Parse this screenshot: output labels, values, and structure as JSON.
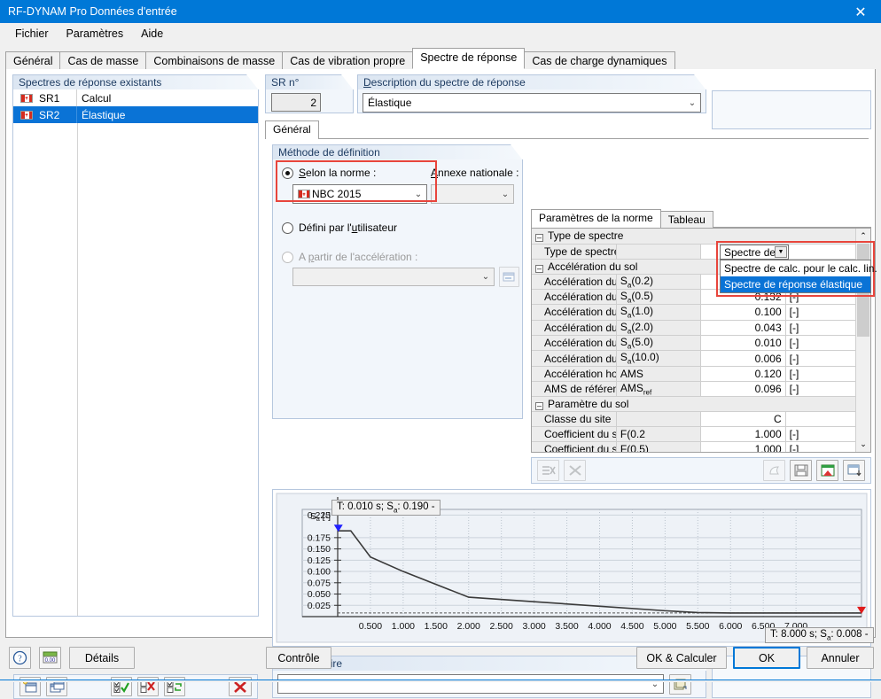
{
  "window": {
    "title": "RF-DYNAM Pro Données d'entrée",
    "close_icon": "close-icon"
  },
  "menu": {
    "items": [
      "Fichier",
      "Paramètres",
      "Aide"
    ]
  },
  "main_tabs": {
    "items": [
      "Général",
      "Cas de masse",
      "Combinaisons de masse",
      "Cas de vibration propre",
      "Spectre de réponse",
      "Cas de charge dynamiques"
    ],
    "active": "Spectre de réponse"
  },
  "existing_spectra": {
    "title": "Spectres de réponse existants",
    "rows": [
      {
        "id": "SR1",
        "desc": "Calcul",
        "flag": "canada-flag-icon",
        "selected": false
      },
      {
        "id": "SR2",
        "desc": "Élastique",
        "flag": "canada-flag-icon",
        "selected": true
      }
    ],
    "toolbar": [
      {
        "name": "new-spectrum-button",
        "glyph": "⊞"
      },
      {
        "name": "copy-spectrum-button",
        "glyph": "⧉"
      },
      {
        "name": "select-all-button",
        "glyph": "☑"
      },
      {
        "name": "deselect-all-button",
        "glyph": "☒"
      },
      {
        "name": "invert-selection-button",
        "glyph": "⮂"
      },
      {
        "name": "delete-spectrum-button",
        "glyph": "✕"
      }
    ]
  },
  "sr_number": {
    "title": "SR n°",
    "value": "2"
  },
  "description": {
    "title": "Description du spectre de réponse",
    "value": "Élastique",
    "chevron": "chevron-down-icon"
  },
  "general_subtab": {
    "label": "Général"
  },
  "definition_method": {
    "title": "Méthode de définition",
    "option_standard": "Selon la norme :",
    "option_standard_selected": true,
    "standard_value": "NBC 2015",
    "standard_flag": "canada-flag-icon",
    "national_annex_label": "Annexe nationale :",
    "national_annex_value": "",
    "option_user": "Défini par l'utilisateur",
    "option_user_selected": false,
    "option_from_accel": "A partir de l'accélération :",
    "option_from_accel_selected": false,
    "accel_value": "",
    "accel_browse_icon": "import-icon"
  },
  "params_panel": {
    "tabs": [
      {
        "label": "Paramètres de la norme",
        "active": true
      },
      {
        "label": "Tableau",
        "active": false
      }
    ],
    "rows": [
      {
        "type": "group",
        "label": "Type de spectre"
      },
      {
        "type": "item",
        "label": "Type de spectre",
        "symbol": "",
        "value": "",
        "unit": ""
      },
      {
        "type": "group",
        "label": "Accélération du sol"
      },
      {
        "type": "item",
        "label": "Accélération du spectre pou",
        "symbol": "Sa(0.2)",
        "value": "",
        "unit": "[-]"
      },
      {
        "type": "item",
        "label": "Accélération du spectre pou",
        "symbol": "Sa(0.5)",
        "value": "0.132",
        "unit": "[-]"
      },
      {
        "type": "item",
        "label": "Accélération du spectre pou",
        "symbol": "Sa(1.0)",
        "value": "0.100",
        "unit": "[-]"
      },
      {
        "type": "item",
        "label": "Accélération du spectre pou",
        "symbol": "Sa(2.0)",
        "value": "0.043",
        "unit": "[-]"
      },
      {
        "type": "item",
        "label": "Accélération du spectre pou",
        "symbol": "Sa(5.0)",
        "value": "0.010",
        "unit": "[-]"
      },
      {
        "type": "item",
        "label": "Accélération du spectre pou",
        "symbol": "Sa(10.0)",
        "value": "0.006",
        "unit": "[-]"
      },
      {
        "type": "item",
        "label": "Accélération horizontale ma",
        "symbol": "AMS",
        "value": "0.120",
        "unit": "[-]"
      },
      {
        "type": "item",
        "label": "AMS de référence pour la d",
        "symbol": "AMSref",
        "value": "0.096",
        "unit": "[-]"
      },
      {
        "type": "group",
        "label": "Paramètre du sol"
      },
      {
        "type": "item",
        "label": "Classe du site",
        "symbol": "",
        "value": "C",
        "unit": ""
      },
      {
        "type": "item",
        "label": "Coefficient du site pour une",
        "symbol": "F(0.2",
        "value": "1.000",
        "unit": "[-]"
      },
      {
        "type": "item",
        "label": "Coefficient du site pour une",
        "symbol": "F(0.5)",
        "value": "1.000",
        "unit": "[-]"
      }
    ],
    "dropdown": {
      "closed_value": "Spectre de",
      "options": [
        {
          "label": "Spectre de calc. pour le calc. lin.",
          "selected": false
        },
        {
          "label": "Spectre de réponse élastique",
          "selected": true
        }
      ]
    },
    "toolbar_left": [
      {
        "name": "clear-row-button",
        "glyph": "⇥✕"
      },
      {
        "name": "clear-all-button",
        "glyph": "✕"
      }
    ],
    "toolbar_right": [
      {
        "name": "print-preview-button",
        "glyph": "⌧"
      },
      {
        "name": "save-button",
        "glyph": "💾"
      },
      {
        "name": "export-excel-button",
        "glyph": "X"
      },
      {
        "name": "import-excel-button",
        "glyph": "X↓"
      }
    ],
    "scrollbar": {
      "up_icon": "chevron-up-icon",
      "down_icon": "chevron-down-icon"
    }
  },
  "chart_data": {
    "type": "line",
    "title": "",
    "xlabel": "",
    "ylabel": "Sa [-]",
    "xlim": [
      0,
      8
    ],
    "ylim": [
      0,
      0.2375
    ],
    "grid": true,
    "x_ticks": [
      "0.500",
      "1.000",
      "1.500",
      "2.000",
      "2.500",
      "3.000",
      "3.500",
      "4.000",
      "4.500",
      "5.000",
      "5.500",
      "6.000",
      "6.500",
      "7.000"
    ],
    "x_tick_values": [
      0.5,
      1.0,
      1.5,
      2.0,
      2.5,
      3.0,
      3.5,
      4.0,
      4.5,
      5.0,
      5.5,
      6.0,
      6.5,
      7.0
    ],
    "y_ticks": [
      "0.225",
      "0.175",
      "0.150",
      "0.125",
      "0.100",
      "0.075",
      "0.050",
      "0.025"
    ],
    "y_tick_values": [
      0.225,
      0.175,
      0.15,
      0.125,
      0.1,
      0.075,
      0.05,
      0.025
    ],
    "series": [
      {
        "name": "Spectre de réponse élastique",
        "color": "#3a3a3a",
        "x": [
          0.01,
          0.2,
          0.5,
          1.0,
          2.0,
          3.0,
          4.0,
          5.0,
          5.5,
          6.0,
          7.0,
          8.0
        ],
        "y": [
          0.19,
          0.19,
          0.132,
          0.1,
          0.043,
          0.033,
          0.023,
          0.013,
          0.009,
          0.008,
          0.008,
          0.008
        ]
      }
    ],
    "markers": [
      {
        "name": "start-marker",
        "x": 0.01,
        "y": 0.19,
        "color": "#2020ff",
        "label": "T: 0.010 s;  Sa: 0.190 -"
      },
      {
        "name": "end-marker",
        "x": 8.0,
        "y": 0.008,
        "color": "#e01b1b",
        "label": "T: 8.000 s;  Sa: 0.008 -"
      }
    ],
    "baseline": {
      "y": 0.008,
      "style": "dashed",
      "color": "#555"
    }
  },
  "comment": {
    "title": "Commentaire",
    "value": "",
    "chevron": "chevron-down-icon",
    "browse_icon": "comment-library-icon"
  },
  "bottom": {
    "help_icon": "help-icon",
    "units_icon": "units-icon",
    "details_label": "Détails",
    "check_label": "Contrôle",
    "ok_calc_label": "OK & Calculer",
    "ok_label": "OK",
    "cancel_label": "Annuler"
  },
  "colors": {
    "accent": "#0078d7",
    "selection": "#0a73d6",
    "highlight_box": "#e8453c",
    "group_header": "#dce6f2"
  }
}
